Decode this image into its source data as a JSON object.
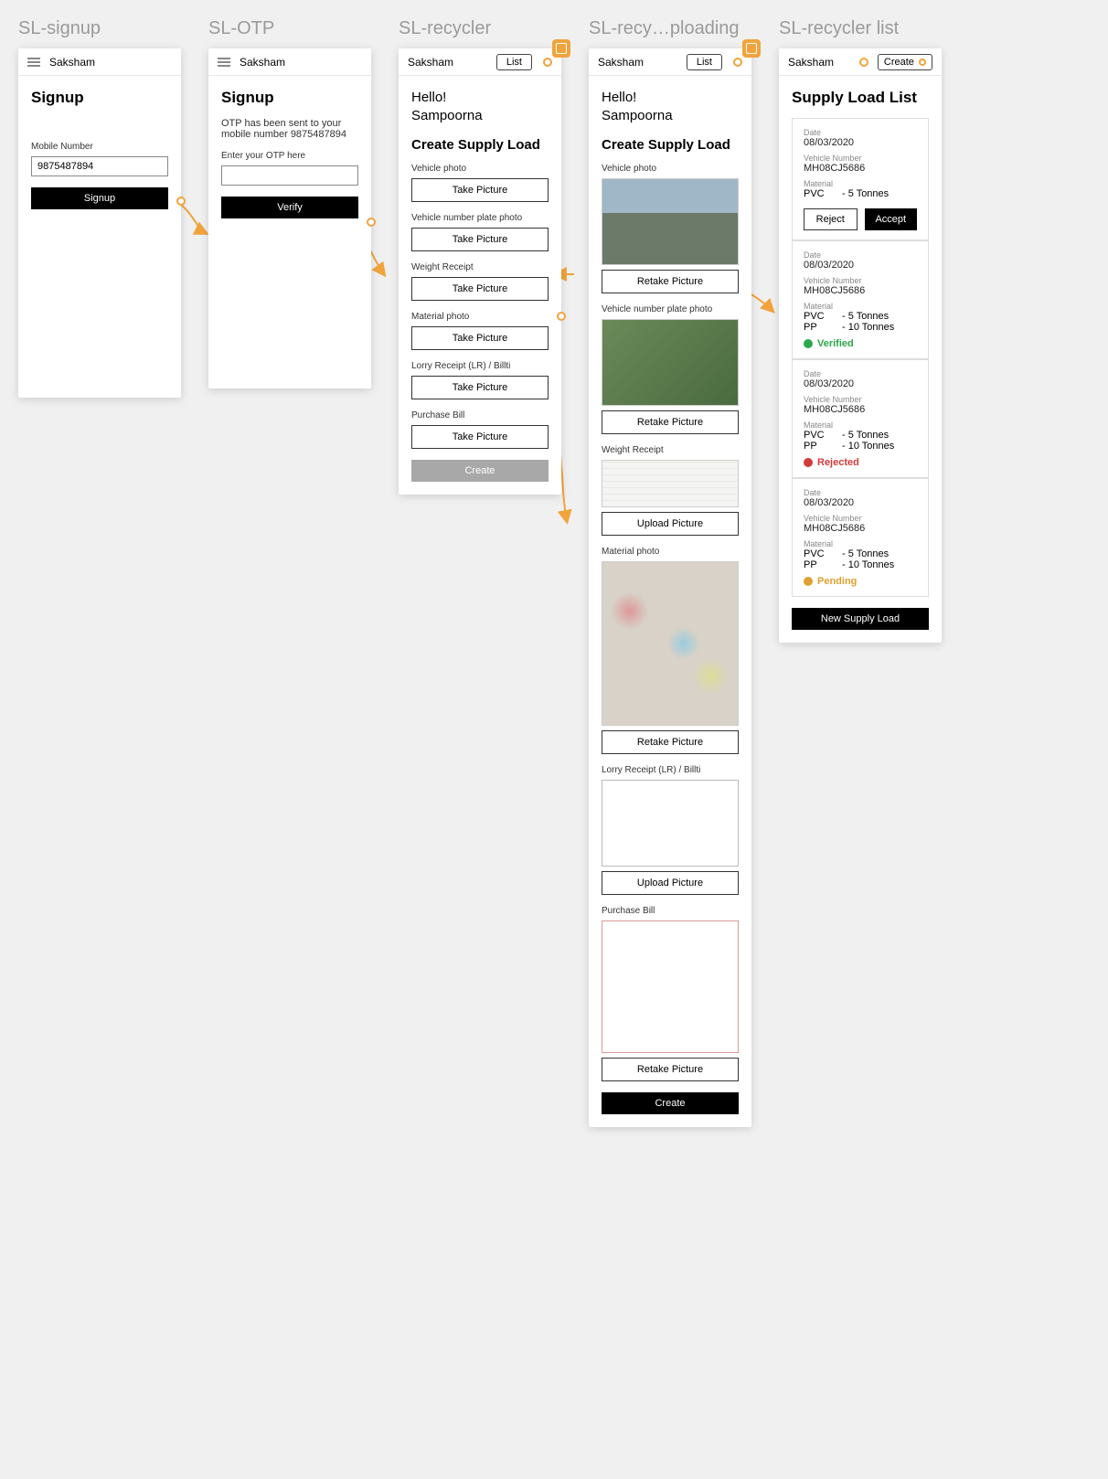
{
  "screens": {
    "signup": {
      "title": "SL-signup",
      "app_name": "Saksham",
      "heading": "Signup",
      "mobile_label": "Mobile Number",
      "mobile_value": "9875487894",
      "submit": "Signup"
    },
    "otp": {
      "title": "SL-OTP",
      "app_name": "Saksham",
      "heading": "Signup",
      "message": "OTP has been sent to your mobile number 9875487894",
      "otp_label": "Enter your OTP here",
      "submit": "Verify"
    },
    "recycler": {
      "title": "SL-recycler",
      "app_name": "Saksham",
      "list_chip": "List",
      "hello": "Hello!",
      "user": "Sampoorna",
      "heading": "Create Supply Load",
      "vehicle_photo": "Vehicle photo",
      "plate_photo": "Vehicle number plate photo",
      "weight_receipt": "Weight Receipt",
      "material_photo": "Material photo",
      "lr": "Lorry Receipt (LR) / Billti",
      "purchase_bill": "Purchase Bill",
      "take_picture": "Take Picture",
      "create": "Create"
    },
    "uploading": {
      "title": "SL-recy…ploading",
      "app_name": "Saksham",
      "list_chip": "List",
      "hello": "Hello!",
      "user": "Sampoorna",
      "heading": "Create Supply Load",
      "vehicle_photo": "Vehicle photo",
      "plate_photo": "Vehicle number plate photo",
      "weight_receipt": "Weight Receipt",
      "material_photo": "Material photo",
      "lr": "Lorry Receipt (LR) / Billti",
      "purchase_bill": "Purchase Bill",
      "retake": "Retake Picture",
      "upload": "Upload Picture",
      "create": "Create"
    },
    "list": {
      "title": "SL-recycler list",
      "app_name": "Saksham",
      "create_chip": "Create",
      "heading": "Supply Load List",
      "labels": {
        "date": "Date",
        "vehicle": "Vehicle Number",
        "material": "Material"
      },
      "reject": "Reject",
      "accept": "Accept",
      "verified": "Verified",
      "rejected": "Rejected",
      "pending": "Pending",
      "new_supply": "New Supply Load",
      "cards": [
        {
          "date": "08/03/2020",
          "vehicle": "MH08CJ5686",
          "materials": [
            {
              "name": "PVC",
              "qty": "- 5 Tonnes"
            }
          ],
          "status": "actions"
        },
        {
          "date": "08/03/2020",
          "vehicle": "MH08CJ5686",
          "materials": [
            {
              "name": "PVC",
              "qty": "- 5 Tonnes"
            },
            {
              "name": "PP",
              "qty": "- 10 Tonnes"
            }
          ],
          "status": "verified"
        },
        {
          "date": "08/03/2020",
          "vehicle": "MH08CJ5686",
          "materials": [
            {
              "name": "PVC",
              "qty": "- 5 Tonnes"
            },
            {
              "name": "PP",
              "qty": "- 10 Tonnes"
            }
          ],
          "status": "rejected"
        },
        {
          "date": "08/03/2020",
          "vehicle": "MH08CJ5686",
          "materials": [
            {
              "name": "PVC",
              "qty": "- 5 Tonnes"
            },
            {
              "name": "PP",
              "qty": "- 10 Tonnes"
            }
          ],
          "status": "pending"
        }
      ]
    }
  }
}
